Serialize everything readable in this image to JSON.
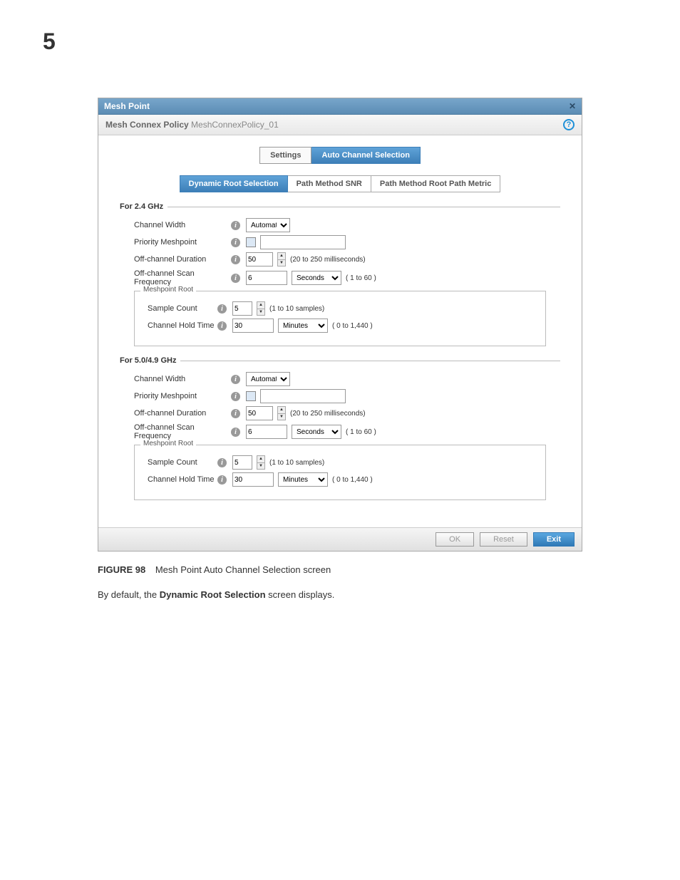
{
  "page_number": "5",
  "panel": {
    "title": "Mesh Point",
    "subtitle_label": "Mesh Connex Policy",
    "subtitle_value": "MeshConnexPolicy_01",
    "help_char": "?",
    "tabs": [
      {
        "label": "Settings",
        "active": false
      },
      {
        "label": "Auto Channel Selection",
        "active": true
      }
    ],
    "subtabs": [
      {
        "label": "Dynamic Root Selection",
        "active": true
      },
      {
        "label": "Path Method SNR",
        "active": false
      },
      {
        "label": "Path Method Root Path Metric",
        "active": false
      }
    ],
    "sections": {
      "band24": {
        "heading": "For 2.4 GHz",
        "channel_width_label": "Channel Width",
        "channel_width_value": "Automatic",
        "priority_meshpoint_label": "Priority Meshpoint",
        "priority_meshpoint_value": "",
        "off_channel_duration_label": "Off-channel Duration",
        "off_channel_duration_value": "50",
        "off_channel_duration_hint": "(20 to 250 milliseconds)",
        "off_channel_scan_freq_label": "Off-channel Scan Frequency",
        "off_channel_scan_freq_value": "6",
        "off_channel_scan_freq_unit": "Seconds",
        "off_channel_scan_freq_hint": "( 1 to 60 )",
        "meshpoint_root_legend": "Meshpoint Root",
        "sample_count_label": "Sample Count",
        "sample_count_value": "5",
        "sample_count_hint": "(1 to 10 samples)",
        "channel_hold_time_label": "Channel Hold Time",
        "channel_hold_time_value": "30",
        "channel_hold_time_unit": "Minutes",
        "channel_hold_time_hint": "( 0 to 1,440 )"
      },
      "band5": {
        "heading": "For 5.0/4.9 GHz",
        "channel_width_label": "Channel Width",
        "channel_width_value": "Automatic",
        "priority_meshpoint_label": "Priority Meshpoint",
        "priority_meshpoint_value": "",
        "off_channel_duration_label": "Off-channel Duration",
        "off_channel_duration_value": "50",
        "off_channel_duration_hint": "(20 to 250 milliseconds)",
        "off_channel_scan_freq_label": "Off-channel Scan Frequency",
        "off_channel_scan_freq_value": "6",
        "off_channel_scan_freq_unit": "Seconds",
        "off_channel_scan_freq_hint": "( 1 to 60 )",
        "meshpoint_root_legend": "Meshpoint Root",
        "sample_count_label": "Sample Count",
        "sample_count_value": "5",
        "sample_count_hint": "(1 to 10 samples)",
        "channel_hold_time_label": "Channel Hold Time",
        "channel_hold_time_value": "30",
        "channel_hold_time_unit": "Minutes",
        "channel_hold_time_hint": "( 0 to 1,440 )"
      }
    },
    "footer": {
      "ok": "OK",
      "reset": "Reset",
      "exit": "Exit"
    }
  },
  "figure": {
    "label": "FIGURE 98",
    "title": "Mesh Point Auto Channel Selection screen"
  },
  "body_text": {
    "pre": "By default, the ",
    "bold": "Dynamic Root Selection",
    "post": " screen displays."
  }
}
